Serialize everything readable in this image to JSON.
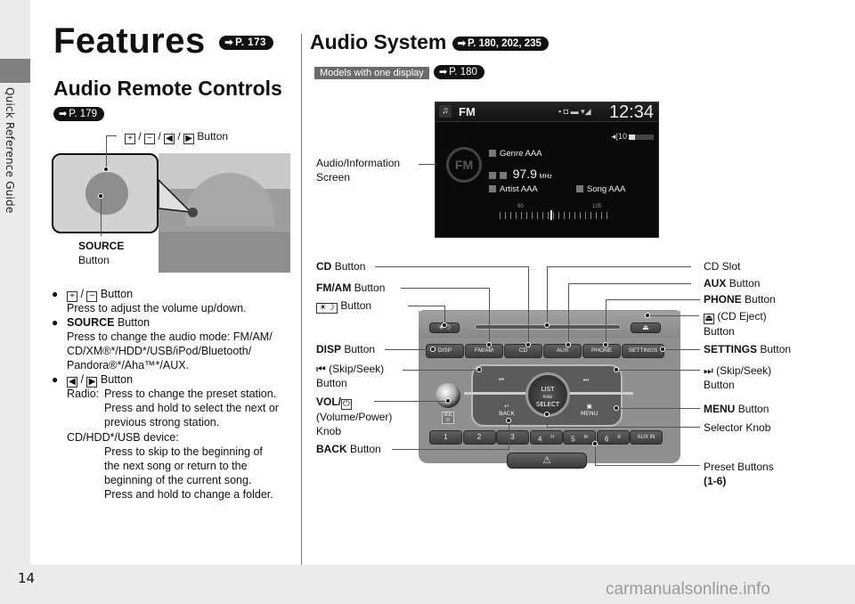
{
  "sidebar": {
    "section_label": "Quick Reference Guide"
  },
  "page_number": "14",
  "watermark": "carmanualsonline.info",
  "left": {
    "title": "Features",
    "title_ref": "P. 173",
    "subtitle": "Audio Remote Controls",
    "subtitle_ref": "P. 179",
    "illustration": {
      "top_callout": {
        "keys": [
          "+",
          "−",
          "◀",
          "▶"
        ],
        "suffix": "Button"
      },
      "source_label_bold": "SOURCE",
      "source_label_rest": "Button"
    },
    "bullets": [
      {
        "keys": [
          "+",
          "−"
        ],
        "title_rest": "Button",
        "lines": [
          "Press to adjust the volume up/down."
        ]
      },
      {
        "title_bold": "SOURCE",
        "title_rest": "Button",
        "lines": [
          "Press to change the audio mode: FM/AM/",
          "CD/XM®*/HDD*/USB/iPod/Bluetooth/",
          "Pandora®*/Aha™*/AUX."
        ]
      },
      {
        "keys": [
          "◀",
          "▶"
        ],
        "title_rest": "Button",
        "radio_label": "Radio:",
        "radio_lines": [
          "Press to change the preset station.",
          "Press and hold to select the next or",
          "previous strong station."
        ],
        "device_label": "CD/HDD*/USB device:",
        "device_lines": [
          "Press to skip to the beginning of",
          "the next song or return to the",
          "beginning of the current song.",
          "Press and hold to change a folder."
        ]
      }
    ]
  },
  "right": {
    "title": "Audio System",
    "title_ref": "P. 180, 202, 235",
    "model_tag": "Models with one display",
    "model_ref": "P. 180",
    "screen": {
      "mode": "FM",
      "clock": "12:34",
      "volume": "10",
      "volume_fraction": 0.25,
      "genre": "Genre AAA",
      "frequency": "97.9",
      "frequency_unit": "MHz",
      "artist": "Artist AAA",
      "song": "Song AAA",
      "scale_low": "90",
      "scale_high": "105",
      "logo": "FM"
    },
    "unit": {
      "row_buttons": [
        "DISP",
        "FM/AM",
        "CD",
        "AUX",
        "PHONE",
        "SETTINGS"
      ],
      "presets": [
        "1",
        "2",
        "3",
        "4",
        "5",
        "6",
        "AUX IN"
      ],
      "preset_marks": {
        "4": "H",
        "5": "M",
        "6": "R"
      },
      "knob_text": [
        "LIST",
        "PUSH",
        "SELECT"
      ],
      "back_label": "BACK",
      "menu_label": "MENU",
      "vol_tag": "VOL"
    },
    "callouts_left": {
      "screen": [
        "Audio/Information",
        "Screen"
      ],
      "cd": {
        "bold": "CD",
        "rest": "Button"
      },
      "fmam": {
        "bold": "FM/AM",
        "rest": "Button"
      },
      "daynight": {
        "rest": "Button"
      },
      "disp": {
        "bold": "DISP",
        "rest": "Button"
      },
      "skip_back": {
        "rest": "(Skip/Seek)",
        "line2": "Button"
      },
      "vol": {
        "bold": "VOL/",
        "line2": "(Volume/Power)",
        "line3": "Knob"
      },
      "back": {
        "bold": "BACK",
        "rest": "Button"
      }
    },
    "callouts_right": {
      "cd_slot": "CD Slot",
      "aux": {
        "bold": "AUX",
        "rest": "Button"
      },
      "phone": {
        "bold": "PHONE",
        "rest": "Button"
      },
      "eject": {
        "rest": "(CD Eject)",
        "line2": "Button"
      },
      "settings": {
        "bold": "SETTINGS",
        "rest": "Button"
      },
      "skip_fwd": {
        "rest": "(Skip/Seek)",
        "line2": "Button"
      },
      "menu": {
        "bold": "MENU",
        "rest": "Button"
      },
      "selector": "Selector Knob",
      "presets": {
        "line1": "Preset Buttons",
        "line2": "(1-6)"
      }
    }
  }
}
